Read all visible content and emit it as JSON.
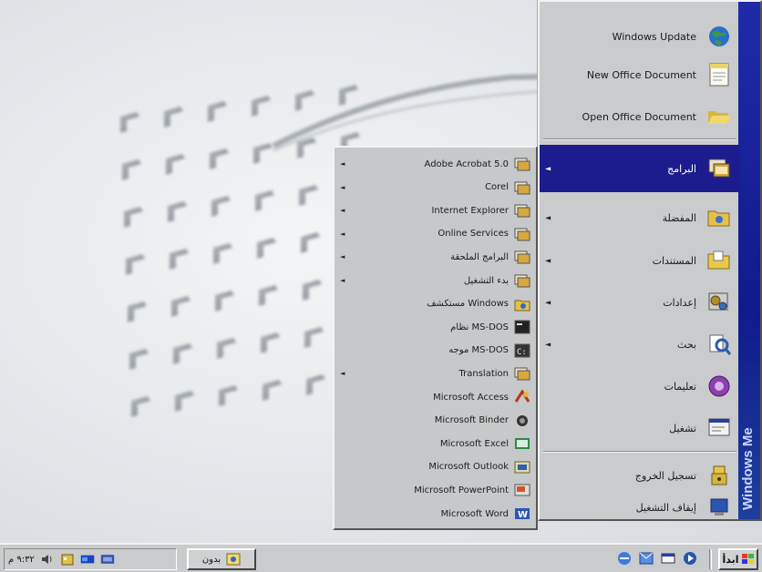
{
  "start_menu": {
    "banner": "Windows Me",
    "top_items": [
      {
        "label": "Windows Update",
        "icon": "globe-icon"
      },
      {
        "label": "New Office Document",
        "icon": "new-document-icon"
      },
      {
        "label": "Open Office Document",
        "icon": "open-folder-icon"
      }
    ],
    "main_items": [
      {
        "label": "البرامج",
        "icon": "programs-icon",
        "has_submenu": true,
        "highlighted": true
      },
      {
        "label": "المفضلة",
        "icon": "favorites-folder-icon",
        "has_submenu": true
      },
      {
        "label": "المستندات",
        "icon": "documents-folder-icon",
        "has_submenu": true
      },
      {
        "label": "إعدادات",
        "icon": "settings-icon",
        "has_submenu": true
      },
      {
        "label": "بحث",
        "icon": "search-icon",
        "has_submenu": true
      },
      {
        "label": "تعليمات",
        "icon": "help-icon",
        "has_submenu": false
      },
      {
        "label": "تشغيل",
        "icon": "run-icon",
        "has_submenu": false
      }
    ],
    "bottom_items": [
      {
        "label": "تسجيل الخروج",
        "icon": "logoff-icon"
      },
      {
        "label": "إيقاف التشغيل",
        "icon": "shutdown-icon"
      }
    ]
  },
  "programs_menu": {
    "items": [
      {
        "label": "Adobe Acrobat 5.0",
        "icon": "program-group-icon",
        "has_submenu": true
      },
      {
        "label": "Corel",
        "icon": "program-group-icon",
        "has_submenu": true
      },
      {
        "label": "Internet Explorer",
        "icon": "program-group-icon",
        "has_submenu": true
      },
      {
        "label": "Online Services",
        "icon": "program-group-icon",
        "has_submenu": true
      },
      {
        "label": "البرامج الملحقة",
        "icon": "program-group-icon",
        "has_submenu": true
      },
      {
        "label": "بدء التشغيل",
        "icon": "program-group-icon",
        "has_submenu": true
      },
      {
        "label": "مستكشف Windows",
        "icon": "explorer-icon",
        "has_submenu": false
      },
      {
        "label": "نظام MS-DOS",
        "icon": "msdos-icon",
        "has_submenu": false
      },
      {
        "label": "موجه MS-DOS",
        "icon": "msdos-prompt-icon",
        "has_submenu": false
      },
      {
        "label": "Translation",
        "icon": "program-group-icon",
        "has_submenu": true
      },
      {
        "label": "Microsoft Access",
        "icon": "access-icon",
        "has_submenu": false
      },
      {
        "label": "Microsoft Binder",
        "icon": "binder-icon",
        "has_submenu": false
      },
      {
        "label": "Microsoft Excel",
        "icon": "excel-icon",
        "has_submenu": false
      },
      {
        "label": "Microsoft Outlook",
        "icon": "outlook-icon",
        "has_submenu": false
      },
      {
        "label": "Microsoft PowerPoint",
        "icon": "powerpoint-icon",
        "has_submenu": false
      },
      {
        "label": "Microsoft Word",
        "icon": "word-icon",
        "has_submenu": false
      }
    ]
  },
  "taskbar": {
    "start_label": "ابدأ",
    "task_label": "بدون",
    "clock": "٩:٣٢ م"
  },
  "colors": {
    "highlight": "#1c1c8f",
    "menu_bg": "#c9cbcc",
    "banner": "#1f2aa8"
  }
}
